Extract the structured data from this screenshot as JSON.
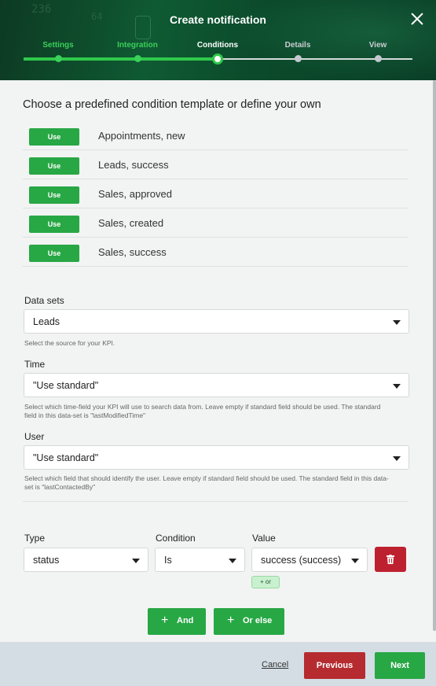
{
  "header": {
    "title": "Create notification",
    "decor_numbers": [
      "236",
      "64"
    ],
    "steps": [
      {
        "label": "Settings",
        "state": "done"
      },
      {
        "label": "Integration",
        "state": "done"
      },
      {
        "label": "Conditions",
        "state": "current"
      },
      {
        "label": "Details",
        "state": "todo"
      },
      {
        "label": "View",
        "state": "todo"
      }
    ]
  },
  "templates": {
    "heading": "Choose a predefined condition template or define your own",
    "use_label": "Use",
    "items": [
      {
        "name": "Appointments, new"
      },
      {
        "name": "Leads, success"
      },
      {
        "name": "Sales, approved"
      },
      {
        "name": "Sales, created"
      },
      {
        "name": "Sales, success"
      }
    ]
  },
  "form": {
    "datasets": {
      "label": "Data sets",
      "value": "Leads",
      "help": "Select the source for your KPI."
    },
    "time": {
      "label": "Time",
      "value": "\"Use standard\"",
      "help": "Select which time-field your KPI will use to search data from. Leave empty if standard field should be used. The standard field in this data-set is \"lastModifiedTime\""
    },
    "user": {
      "label": "User",
      "value": "\"Use standard\"",
      "help": "Select which field that should identify the user. Leave empty if standard field should be used. The standard field in this data-set is \"lastContactedBy\""
    }
  },
  "condition": {
    "type_label": "Type",
    "type_value": "status",
    "condition_label": "Condition",
    "condition_value": "Is",
    "value_label": "Value",
    "value_value": "success (success)",
    "or_label": "+ or",
    "and_button": "And",
    "or_else_button": "Or else"
  },
  "footer": {
    "cancel": "Cancel",
    "previous": "Previous",
    "next": "Next"
  },
  "colors": {
    "primary_green": "#28a745",
    "danger_red": "#b52b30",
    "header_green": "#0f5a33",
    "progress_green": "#2fc94a"
  }
}
